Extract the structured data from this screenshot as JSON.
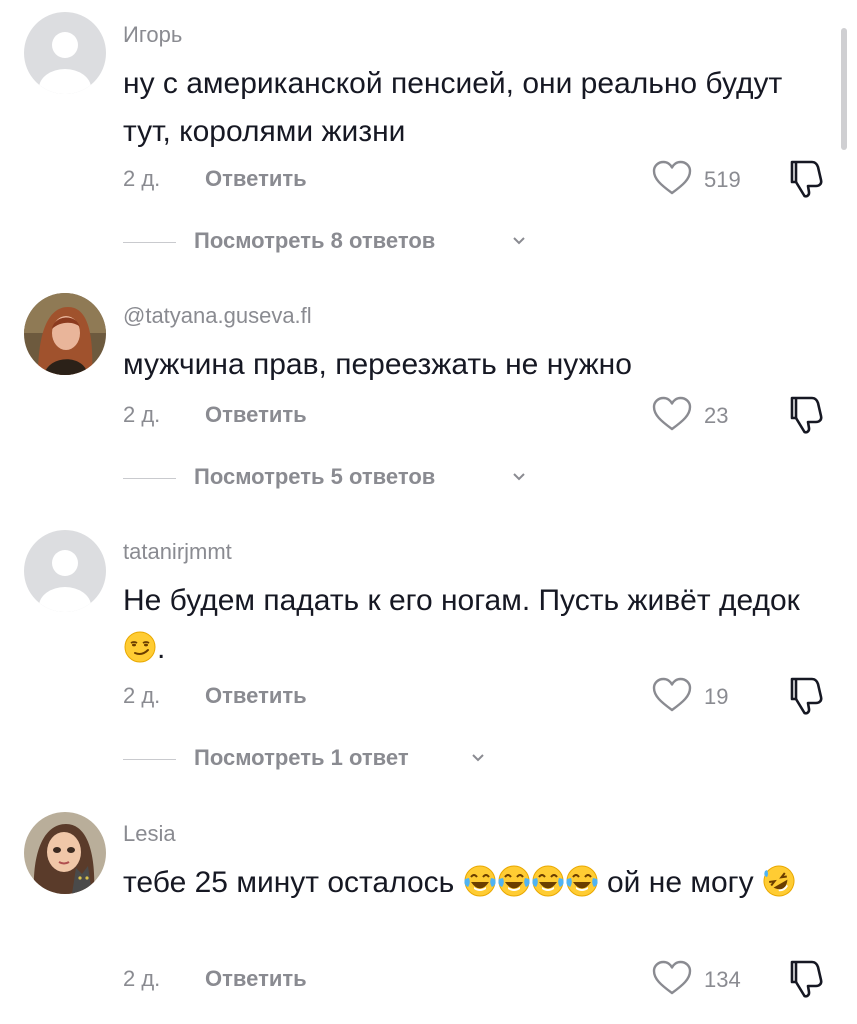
{
  "comments": [
    {
      "username": "Игорь",
      "text_parts": [
        "ну с американской пенсией, они реально будут тут, королями жизни"
      ],
      "time": "2 д.",
      "reply_label": "Ответить",
      "likes": "519",
      "view_replies": "Посмотреть 8 ответов",
      "avatar": "default-avatar"
    },
    {
      "username": "@tatyana.guseva.fl",
      "text_parts": [
        "мужчина прав, переезжать не нужно"
      ],
      "time": "2 д.",
      "reply_label": "Ответить",
      "likes": "23",
      "view_replies": "Посмотреть 5 ответов",
      "avatar": "photo-avatar-woman"
    },
    {
      "username": "tatanirjmmt",
      "text_parts": [
        "Не будем падать к его ногам. Пусть живёт дедок",
        "."
      ],
      "time": "2 д.",
      "reply_label": "Ответить",
      "likes": "19",
      "view_replies": "Посмотреть 1 ответ",
      "avatar": "default-avatar",
      "emoji": [
        "smirking-face"
      ]
    },
    {
      "username": "Lesia",
      "text_parts": [
        "тебе 25 минут осталось",
        "ой не могу"
      ],
      "time": "2 д.",
      "reply_label": "Ответить",
      "likes": "134",
      "avatar": "drawn-avatar-girl-with-cat",
      "emoji": [
        "face-with-tears-of-joy",
        "face-with-tears-of-joy",
        "face-with-tears-of-joy",
        "face-with-tears-of-joy",
        "rolling-on-the-floor-laughing"
      ]
    }
  ],
  "icons": {
    "like": "heart-outline-icon",
    "dislike": "thumbs-down-outline-icon",
    "expand": "chevron-down-icon"
  },
  "colors": {
    "text": "#161823",
    "secondary": "#8a8b91",
    "default_avatar_bg": "#dcdde0"
  }
}
